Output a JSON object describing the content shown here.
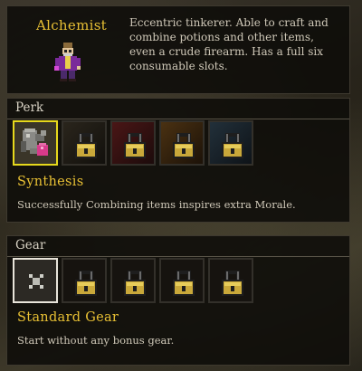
{
  "class_info": {
    "name": "Alchemist",
    "description": "Eccentric tinkerer. Able to craft and combine potions and other items, even a crude firearm. Has a full six consumable slots."
  },
  "perk": {
    "section_title": "Perk",
    "selected_name": "Synthesis",
    "selected_description": "Successfully Combining items inspires extra Morale.",
    "slots": [
      {
        "state": "unlocked",
        "icon": "synthesis-icon"
      },
      {
        "state": "locked",
        "icon": "lock-icon"
      },
      {
        "state": "locked",
        "icon": "lock-icon"
      },
      {
        "state": "locked",
        "icon": "lock-icon"
      },
      {
        "state": "locked",
        "icon": "lock-icon"
      }
    ]
  },
  "gear": {
    "section_title": "Gear",
    "selected_name": "Standard Gear",
    "selected_description": "Start without any bonus gear.",
    "slots": [
      {
        "state": "unlocked",
        "icon": "x-icon"
      },
      {
        "state": "locked",
        "icon": "lock-icon"
      },
      {
        "state": "locked",
        "icon": "lock-icon"
      },
      {
        "state": "locked",
        "icon": "lock-icon"
      },
      {
        "state": "locked",
        "icon": "lock-icon"
      }
    ]
  },
  "colors": {
    "accent_gold": "#e8c034",
    "perk_selected_border": "#e6d81c",
    "gear_selected_border": "#e8e4da",
    "body_text": "#cfc8b8"
  }
}
